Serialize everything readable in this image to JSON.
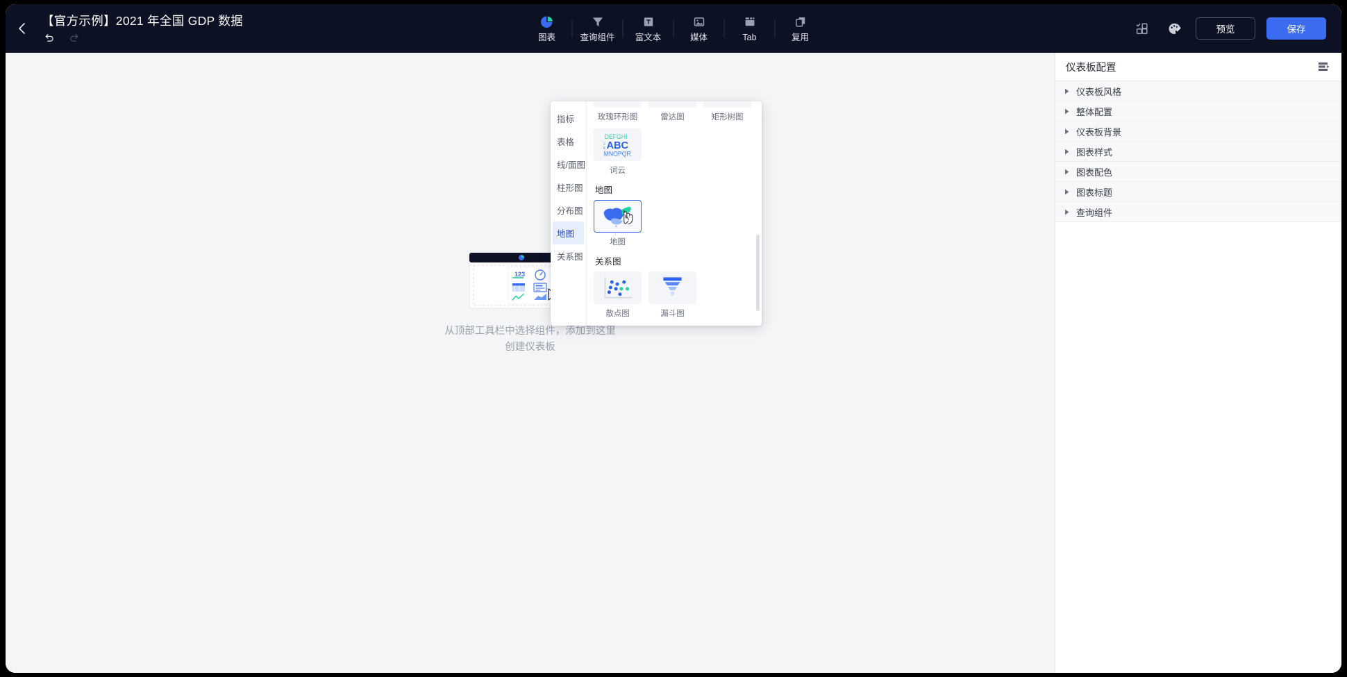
{
  "topbar": {
    "back_icon": "chevron-left-icon",
    "title": "【官方示例】2021 年全国 GDP 数据",
    "undo_icon": "undo-icon",
    "redo_icon": "redo-icon",
    "tools": [
      {
        "label": "图表",
        "icon": "pie-chart-icon"
      },
      {
        "label": "查询组件",
        "icon": "filter-icon"
      },
      {
        "label": "富文本",
        "icon": "text-box-icon"
      },
      {
        "label": "媒体",
        "icon": "image-icon"
      },
      {
        "label": "Tab",
        "icon": "tab-icon"
      },
      {
        "label": "复用",
        "icon": "copy-icon"
      }
    ],
    "actions": {
      "layout_icon": "layout-grid-icon",
      "theme_icon": "palette-icon",
      "preview_label": "预览",
      "save_label": "保存"
    }
  },
  "canvas": {
    "empty_art_icon": "dashboard-placeholder-illustration",
    "empty_text": "从顶部工具栏中选择组件，添加到这里\n创建仪表板"
  },
  "dropdown": {
    "nav": [
      {
        "label": "指标",
        "active": false
      },
      {
        "label": "表格",
        "active": false
      },
      {
        "label": "线/面图",
        "active": false
      },
      {
        "label": "柱形图",
        "active": false
      },
      {
        "label": "分布图",
        "active": false
      },
      {
        "label": "地图",
        "active": true
      },
      {
        "label": "关系图",
        "active": false
      }
    ],
    "partial_row": [
      {
        "label": "玫瑰环形图",
        "icon": "rose-donut-chart-icon"
      },
      {
        "label": "雷达图",
        "icon": "radar-chart-icon"
      },
      {
        "label": "矩形树图",
        "icon": "treemap-chart-icon"
      }
    ],
    "wordcloud_row": [
      {
        "label": "词云",
        "icon": "word-cloud-icon"
      }
    ],
    "groups": [
      {
        "title": "地图",
        "items": [
          {
            "label": "地图",
            "icon": "china-map-icon",
            "selected": true
          }
        ]
      },
      {
        "title": "关系图",
        "items": [
          {
            "label": "散点图",
            "icon": "scatter-chart-icon",
            "selected": false
          },
          {
            "label": "漏斗图",
            "icon": "funnel-chart-icon",
            "selected": false
          }
        ]
      }
    ],
    "wordcloud_letters": {
      "top": "DEFGHI",
      "left_upper": "J",
      "left_lower": "K",
      "middle": "ABC",
      "bottom": "MNOPQR"
    }
  },
  "right_panel": {
    "title": "仪表板配置",
    "menu_icon": "panel-collapse-icon",
    "sections": [
      {
        "label": "仪表板风格"
      },
      {
        "label": "整体配置"
      },
      {
        "label": "仪表板背景"
      },
      {
        "label": "图表样式"
      },
      {
        "label": "图表配色"
      },
      {
        "label": "图表标题"
      },
      {
        "label": "查询组件"
      }
    ]
  },
  "colors": {
    "topbar_bg": "#0c1124",
    "primary": "#3b6bf0",
    "canvas_bg": "#f4f5f7",
    "accent_green": "#22d3a5"
  }
}
